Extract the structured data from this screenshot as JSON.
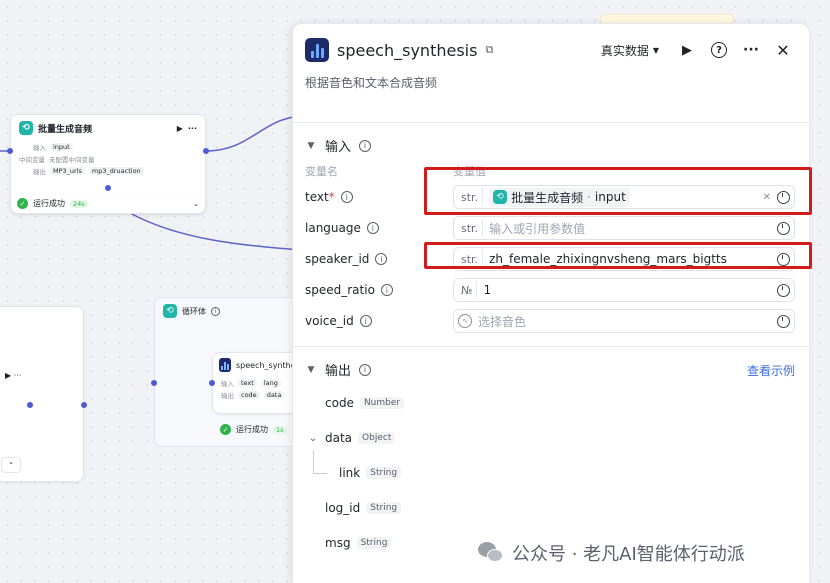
{
  "canvas": {
    "batch_node": {
      "title": "批量生成音频",
      "in_label": "输入",
      "in_chip": "input",
      "mid_label": "中间变量",
      "mid_value": "未配置中间变量",
      "out_label": "输出",
      "out_chips": [
        "MP3_urls",
        "mp3_druaction"
      ],
      "status": "运行成功",
      "time": "24s"
    },
    "loop_node": {
      "title": "循环体",
      "inner_title": "speech_synthesis",
      "in_label": "输入",
      "in_chips": [
        "text",
        "lang"
      ],
      "out_label": "输出",
      "out_chips": [
        "code",
        "data"
      ],
      "status": "运行成功",
      "time": "1s"
    }
  },
  "panel": {
    "title": "speech_synthesis",
    "mode": "真实数据",
    "description": "根据音色和文本合成音频",
    "input_section": "输入",
    "col_var_name": "变量名",
    "col_var_value": "变量值",
    "params": [
      {
        "label": "text",
        "required": "*",
        "type": "str.",
        "ref_node": "批量生成音频",
        "ref_sep": "·",
        "ref_var": "input"
      },
      {
        "label": "language",
        "type": "str.",
        "placeholder": "输入或引用参数值"
      },
      {
        "label": "speaker_id",
        "type": "str.",
        "value": "zh_female_zhixingnvsheng_mars_bigtts"
      },
      {
        "label": "speed_ratio",
        "type": "№",
        "value": "1"
      },
      {
        "label": "voice_id",
        "placeholder": "选择音色"
      }
    ],
    "output_section": "输出",
    "example_link": "查看示例",
    "outputs": [
      {
        "name": "code",
        "type": "Number"
      },
      {
        "name": "data",
        "type": "Object"
      },
      {
        "name": "link",
        "type": "String"
      },
      {
        "name": "log_id",
        "type": "String"
      },
      {
        "name": "msg",
        "type": "String"
      }
    ]
  },
  "watermark": "公众号 · 老凡AI智能体行动派",
  "colors": {
    "accent": "#4c5bd4",
    "highlight": "#d21c1c",
    "success": "#2fb34a",
    "link": "#3c6ee0"
  }
}
